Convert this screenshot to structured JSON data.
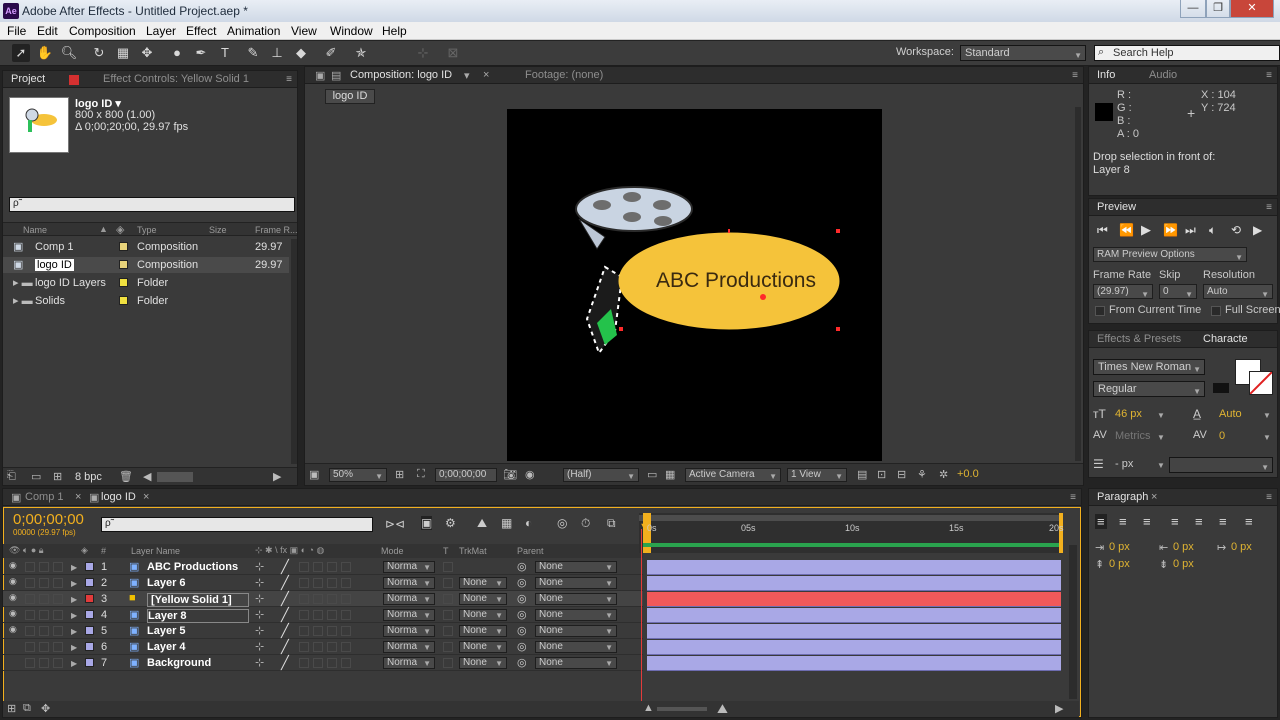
{
  "window": {
    "title": "Adobe After Effects - Untitled Project.aep *",
    "app_logo": "Ae"
  },
  "menu": [
    "File",
    "Edit",
    "Composition",
    "Layer",
    "Effect",
    "Animation",
    "View",
    "Window",
    "Help"
  ],
  "toolbar": {
    "workspace_label": "Workspace:",
    "workspace_value": "Standard",
    "search_placeholder": "Search Help"
  },
  "project_panel": {
    "tab_project": "Project",
    "tab_effect_controls": "Effect Controls: Yellow Solid 1",
    "comp_name": "logo ID ▾",
    "comp_size": "800 x 800 (1.00)",
    "comp_duration": "Δ 0;00;20;00, 29.97 fps",
    "search_value": "ρ˜",
    "columns": [
      "Name",
      "Type",
      "Size",
      "Frame R..."
    ],
    "items": [
      {
        "name": "Comp 1",
        "type": "Composition",
        "fps": "29.97",
        "color": "#e8d37a",
        "kind": "comp"
      },
      {
        "name": "logo ID",
        "type": "Composition",
        "fps": "29.97",
        "color": "#e8d37a",
        "kind": "comp"
      },
      {
        "name": "logo ID Layers",
        "type": "Folder",
        "fps": "",
        "color": "#f0e040",
        "kind": "folder"
      },
      {
        "name": "Solids",
        "type": "Folder",
        "fps": "",
        "color": "#f0e040",
        "kind": "folder"
      }
    ],
    "bpc": "8 bpc"
  },
  "comp_panel": {
    "tab_comp": "Composition: logo ID",
    "tab_footage": "Footage: (none)",
    "breadcrumb": "logo ID",
    "canvas_text": "ABC Productions",
    "zoom": "50%",
    "timecode": "0;00;00;00",
    "resolution": "(Half)",
    "camera": "Active Camera",
    "views": "1 View",
    "exposure": "+0.0"
  },
  "info_panel": {
    "tab_info": "Info",
    "tab_audio": "Audio",
    "r": "R :",
    "g": "G :",
    "b": "B :",
    "a": "A : 0",
    "x": "X : 104",
    "y": "Y : 724",
    "message": "Drop selection in front of:",
    "message_target": "Layer 8"
  },
  "preview_panel": {
    "tab": "Preview",
    "ram_options": "RAM Preview Options",
    "frame_rate_label": "Frame Rate",
    "skip_label": "Skip",
    "resolution_label": "Resolution",
    "frame_rate": "(29.97)",
    "skip": "0",
    "resolution": "Auto",
    "from_current": "From Current Time",
    "full_screen": "Full Screen"
  },
  "character_panel": {
    "tab_effects": "Effects & Presets",
    "tab_character": "Characte",
    "font": "Times New Roman",
    "style": "Regular",
    "size": "46 px",
    "leading": "Auto",
    "kerning": "Metrics",
    "tracking": "0",
    "stroke": "- px"
  },
  "paragraph_panel": {
    "tab": "Paragraph",
    "indent1": "0 px",
    "indent2": "0 px",
    "indent3": "0 px",
    "space1": "0 px",
    "space2": "0 px"
  },
  "timeline": {
    "tab_comp1": "Comp 1",
    "tab_logo": "logo ID",
    "timecode": "0;00;00;00",
    "frame_info": "00000 (29.97 fps)",
    "search_value": "ρ˜",
    "col_layer_name": "Layer Name",
    "col_mode": "Mode",
    "col_t": "T",
    "col_trkmat": "TrkMat",
    "col_parent": "Parent",
    "ruler": [
      "0s",
      "05s",
      "10s",
      "15s",
      "20s"
    ],
    "layers": [
      {
        "num": "1",
        "name": "ABC Productions",
        "label": "#a9a8e6",
        "mode": "Norma",
        "trkmat": "",
        "parent": "None",
        "bar": "#a9a8e6",
        "eye": true
      },
      {
        "num": "2",
        "name": "Layer 6",
        "label": "#a9a8e6",
        "mode": "Norma",
        "trkmat": "None",
        "parent": "None",
        "bar": "#a9a8e6",
        "eye": true
      },
      {
        "num": "3",
        "name": "[Yellow Solid 1]",
        "label": "#e23b3b",
        "mode": "Norma",
        "trkmat": "None",
        "parent": "None",
        "bar": "#f0595a",
        "eye": true
      },
      {
        "num": "4",
        "name": "Layer 8",
        "label": "#a9a8e6",
        "mode": "Norma",
        "trkmat": "None",
        "parent": "None",
        "bar": "#a9a8e6",
        "eye": true
      },
      {
        "num": "5",
        "name": "Layer 5",
        "label": "#a9a8e6",
        "mode": "Norma",
        "trkmat": "None",
        "parent": "None",
        "bar": "#a9a8e6",
        "eye": true
      },
      {
        "num": "6",
        "name": "Layer 4",
        "label": "#a9a8e6",
        "mode": "Norma",
        "trkmat": "None",
        "parent": "None",
        "bar": "#a9a8e6",
        "eye": false
      },
      {
        "num": "7",
        "name": "Background",
        "label": "#a9a8e6",
        "mode": "Norma",
        "trkmat": "None",
        "parent": "None",
        "bar": "#a9a8e6",
        "eye": false
      }
    ]
  },
  "colors": {
    "accent": "#f2b01e",
    "label_yellow": "#f0e040",
    "ellipse": "#f5c33a"
  }
}
